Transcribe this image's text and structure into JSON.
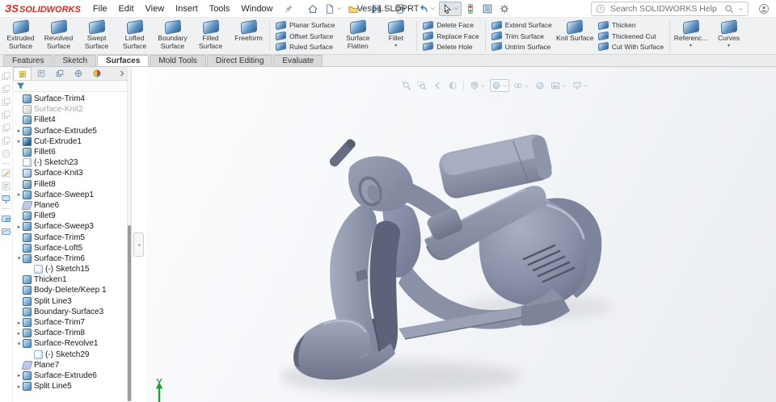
{
  "colors": {
    "brand_red": "#d42a23",
    "model_body": "#8b92a9",
    "model_light": "#a9afc3",
    "model_dark": "#5d6379",
    "triad_green": "#1e9e3a",
    "viewport_bg": "#eef1f4"
  },
  "titlebar": {
    "logo_mark": "ЗS",
    "logo_text": "SOLIDWORKS",
    "menus": [
      "File",
      "Edit",
      "View",
      "Insert",
      "Tools",
      "Window"
    ],
    "pin_icon": "pin",
    "quick_access": [
      {
        "name": "home"
      },
      {
        "name": "new-document",
        "dropdown": true
      },
      {
        "name": "open",
        "dropdown": true
      },
      {
        "name": "save",
        "dropdown": true
      },
      {
        "name": "print",
        "dropdown": true
      },
      {
        "name": "undo",
        "dropdown": true
      },
      {
        "name": "select-cursor",
        "dropdown": true,
        "pressed": true
      },
      {
        "name": "rebuild"
      },
      {
        "name": "options-list"
      },
      {
        "name": "settings-gear"
      }
    ],
    "document_title": "Vespa.SLDPRT",
    "search_placeholder": "Search SOLIDWORKS Help",
    "search_icons": [
      "question",
      "magnifier",
      "chevron-down"
    ],
    "user_icon": "user"
  },
  "ribbon": {
    "groups": [
      {
        "type": "large",
        "items": [
          {
            "label": "Extruded Surface"
          },
          {
            "label": "Revolved Surface"
          },
          {
            "label": "Swept Surface"
          },
          {
            "label": "Lofted Surface"
          },
          {
            "label": "Boundary Surface"
          },
          {
            "label": "Filled Surface"
          },
          {
            "label": "Freeform"
          }
        ]
      },
      {
        "type": "sep"
      },
      {
        "type": "smallcol",
        "items": [
          {
            "label": "Planar Surface"
          },
          {
            "label": "Offset Surface"
          },
          {
            "label": "Ruled Surface"
          }
        ]
      },
      {
        "type": "large",
        "items": [
          {
            "label": "Surface Flatten"
          },
          {
            "label": "Fillet",
            "dropdown": true
          }
        ]
      },
      {
        "type": "sep"
      },
      {
        "type": "smallcol",
        "items": [
          {
            "label": "Delete Face"
          },
          {
            "label": "Replace Face"
          },
          {
            "label": "Delete Hole"
          }
        ]
      },
      {
        "type": "sep"
      },
      {
        "type": "smallcol",
        "items": [
          {
            "label": "Extend Surface"
          },
          {
            "label": "Trim Surface"
          },
          {
            "label": "Untrim Surface"
          }
        ]
      },
      {
        "type": "large",
        "items": [
          {
            "label": "Knit Surface"
          }
        ]
      },
      {
        "type": "smallcol",
        "items": [
          {
            "label": "Thicken"
          },
          {
            "label": "Thickened Cut"
          },
          {
            "label": "Cut With Surface"
          }
        ]
      },
      {
        "type": "sep"
      },
      {
        "type": "large",
        "items": [
          {
            "label": "Referenc...",
            "dropdown": true
          },
          {
            "label": "Curves",
            "dropdown": true
          }
        ]
      }
    ]
  },
  "command_tabs": [
    {
      "label": "Features"
    },
    {
      "label": "Sketch"
    },
    {
      "label": "Surfaces",
      "active": true
    },
    {
      "label": "Mold Tools"
    },
    {
      "label": "Direct Editing"
    },
    {
      "label": "Evaluate"
    }
  ],
  "feature_panel": {
    "tabs": [
      "featuremanager",
      "propertymanager",
      "configurations",
      "dimxpert",
      "displaymanager"
    ],
    "overflow_icon": "chevron-right",
    "filter_icon": "funnel",
    "tree": [
      {
        "label": "Surface-Trim4",
        "icon": "trim"
      },
      {
        "label": "Surface-Knit2",
        "icon": "knit",
        "grayed": true
      },
      {
        "label": "Fillet4",
        "icon": "fillet"
      },
      {
        "label": "Surface-Extrude5",
        "icon": "extrude",
        "arrow": "collapsed"
      },
      {
        "label": "Cut-Extrude1",
        "icon": "cut",
        "arrow": "collapsed"
      },
      {
        "label": "Fillet6",
        "icon": "fillet"
      },
      {
        "label": "(-) Sketch23",
        "icon": "sketch"
      },
      {
        "label": "Surface-Knit3",
        "icon": "knit"
      },
      {
        "label": "Fillet8",
        "icon": "fillet"
      },
      {
        "label": "Surface-Sweep1",
        "icon": "sweep",
        "arrow": "collapsed"
      },
      {
        "label": "Plane6",
        "icon": "plane"
      },
      {
        "label": "Fillet9",
        "icon": "fillet"
      },
      {
        "label": "Surface-Sweep3",
        "icon": "sweep",
        "arrow": "collapsed"
      },
      {
        "label": "Surface-Trim5",
        "icon": "trim"
      },
      {
        "label": "Surface-Loft5",
        "icon": "loft"
      },
      {
        "label": "Surface-Trim6",
        "icon": "trim",
        "arrow": "expanded"
      },
      {
        "label": "(-) Sketch15",
        "icon": "sketch",
        "indent": 1
      },
      {
        "label": "Thicken1",
        "icon": "thicken"
      },
      {
        "label": "Body-Delete/Keep 1",
        "icon": "bodydelete"
      },
      {
        "label": "Split Line3",
        "icon": "splitline"
      },
      {
        "label": "Boundary-Surface3",
        "icon": "boundary"
      },
      {
        "label": "Surface-Trim7",
        "icon": "trim",
        "arrow": "collapsed"
      },
      {
        "label": "Surface-Trim8",
        "icon": "trim",
        "arrow": "collapsed"
      },
      {
        "label": "Surface-Revolve1",
        "icon": "revolve",
        "arrow": "expanded"
      },
      {
        "label": "(-) Sketch29",
        "icon": "sketch",
        "indent": 1
      },
      {
        "label": "Plane7",
        "icon": "plane"
      },
      {
        "label": "Surface-Extrude6",
        "icon": "extrude",
        "arrow": "collapsed"
      },
      {
        "label": "Split Line5",
        "icon": "splitline",
        "arrow": "collapsed"
      }
    ]
  },
  "left_toolbar": [
    "ghost-cube",
    "ghost-cube",
    "ghost-cube",
    "ghost-cube",
    "ghost-cube",
    "ghost-cube",
    "ghost-sphere",
    "sep",
    "sketch-edit",
    "note-edit",
    "monitor-tool",
    "sep",
    "body-folder",
    "surface-folder"
  ],
  "heads_up": [
    {
      "name": "zoom-fit"
    },
    {
      "name": "zoom-area"
    },
    {
      "name": "previous-view"
    },
    {
      "name": "section-view"
    },
    {
      "sep": true
    },
    {
      "name": "view-orientation",
      "dropdown": true
    },
    {
      "name": "display-style",
      "dropdown": true,
      "pressed": true
    },
    {
      "name": "hide-show-items",
      "dropdown": true
    },
    {
      "name": "edit-appearance"
    },
    {
      "name": "apply-scene",
      "dropdown": true
    },
    {
      "name": "view-settings",
      "dropdown": true
    }
  ]
}
